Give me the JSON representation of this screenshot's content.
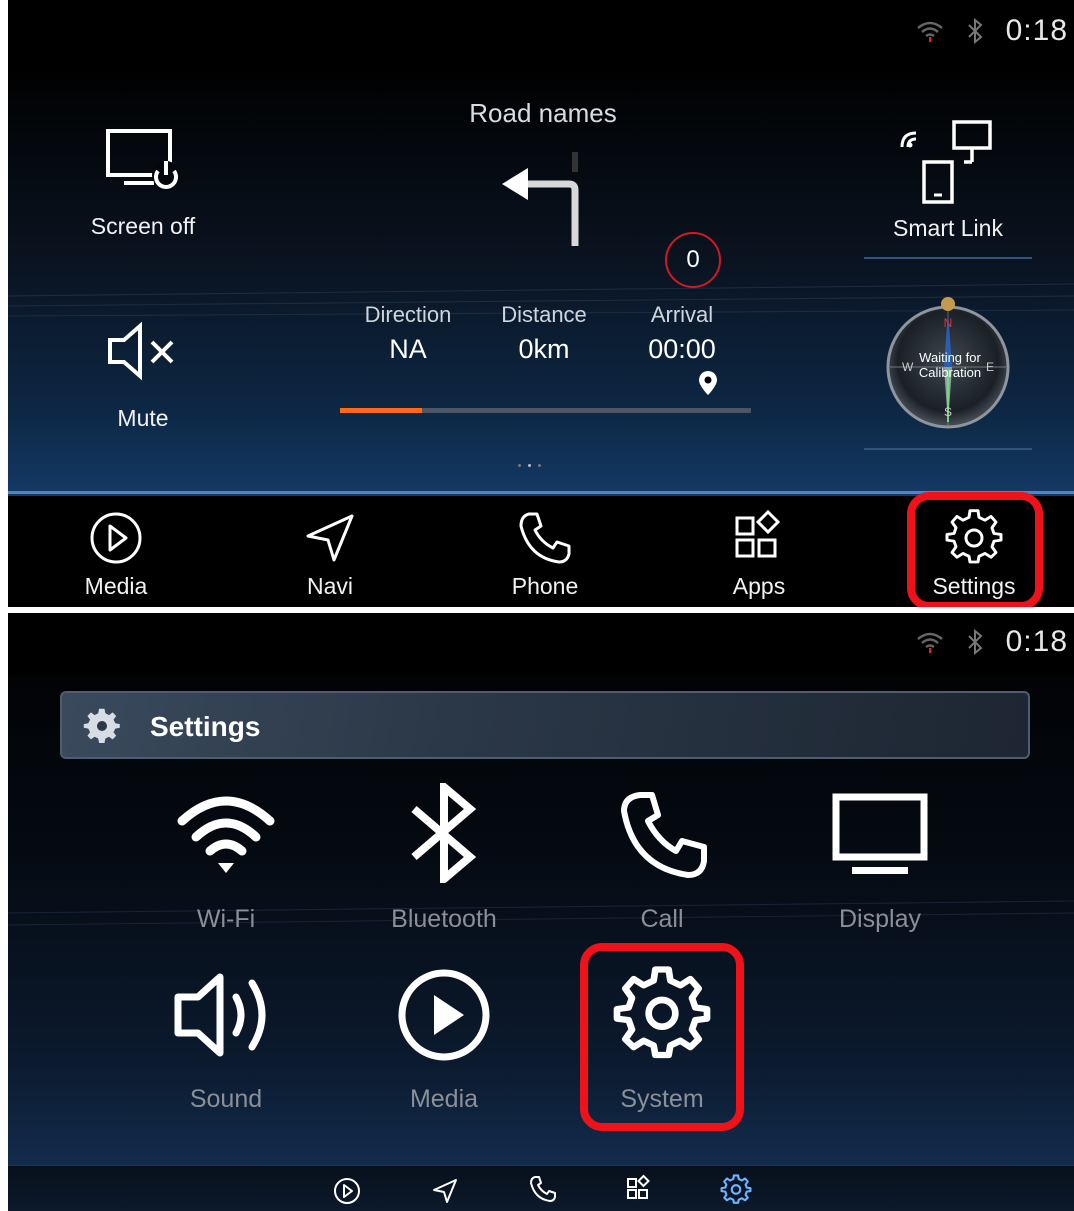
{
  "status": {
    "time": "0:18",
    "icons": [
      "wifi-icon",
      "bluetooth-icon"
    ]
  },
  "home": {
    "road_names": "Road names",
    "screen_off_label": "Screen off",
    "mute_label": "Mute",
    "smart_link_label": "Smart Link",
    "badge_count": "0",
    "direction": {
      "label": "Direction",
      "value": "NA"
    },
    "distance": {
      "label": "Distance",
      "value": "0km"
    },
    "arrival": {
      "label": "Arrival",
      "value": "00:00"
    },
    "route_progress": 0.2,
    "compass": {
      "text": "Waiting for Calibration",
      "n": "N",
      "s": "S",
      "e": "E",
      "w": "W"
    },
    "dock": [
      "Media",
      "Navi",
      "Phone",
      "Apps",
      "Settings"
    ]
  },
  "settings": {
    "title": "Settings",
    "items": [
      {
        "label": "Wi-Fi",
        "icon": "wifi-icon"
      },
      {
        "label": "Bluetooth",
        "icon": "bluetooth-icon"
      },
      {
        "label": "Call",
        "icon": "phone-icon"
      },
      {
        "label": "Display",
        "icon": "display-icon"
      },
      {
        "label": "Sound",
        "icon": "speaker-icon"
      },
      {
        "label": "Media",
        "icon": "play-icon"
      },
      {
        "label": "System",
        "icon": "gear-icon"
      }
    ]
  },
  "colors": {
    "highlight": "#f0121b",
    "progress": "#ff6a13",
    "accent_blue": "#3f7ecf"
  }
}
